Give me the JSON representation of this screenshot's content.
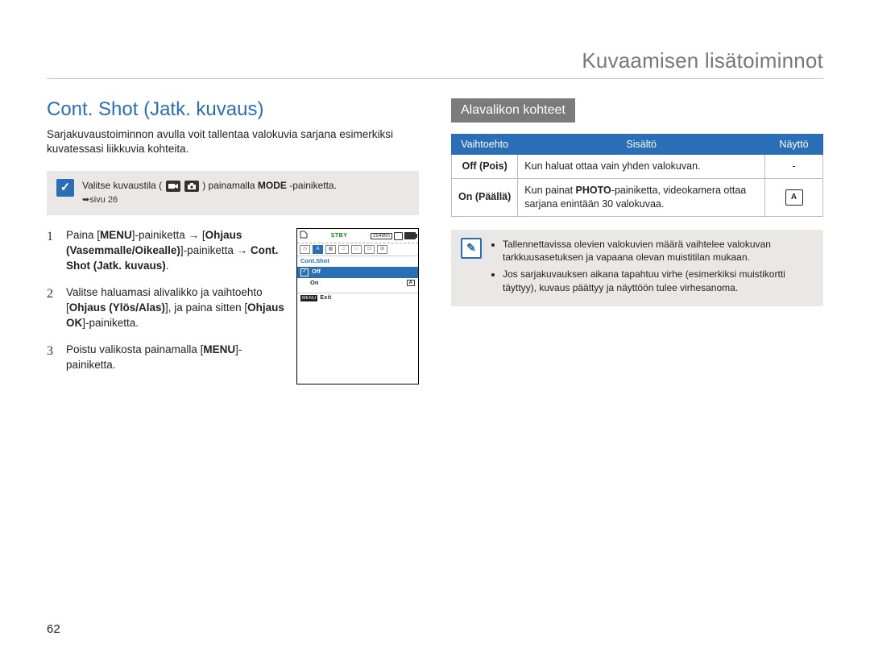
{
  "header": {
    "title": "Kuvaamisen lisätoiminnot"
  },
  "left": {
    "section_title": "Cont. Shot (Jatk. kuvaus)",
    "intro": "Sarjakuvaustoiminnon avulla voit tallentaa valokuvia sarjana esimerkiksi kuvatessasi liikkuvia kohteita.",
    "note": {
      "pre": "Valitse kuvaustila (",
      "post": ") painamalla ",
      "mode": "MODE",
      "suffix": "-painiketta.",
      "pageref": "➥sivu 26"
    },
    "steps": [
      {
        "num": "1",
        "parts": {
          "a": "Paina [",
          "menu": "MENU",
          "b": "]-painiketta ",
          "arrow1": "→",
          "c": " [",
          "ctrl_lr": "Ohjaus (Vasemmalle/Oikealle)",
          "d": "]-painiketta ",
          "arrow2": "→",
          "e": " ",
          "cont": "Cont. Shot (Jatk. kuvaus)",
          "end": "."
        }
      },
      {
        "num": "2",
        "parts": {
          "a": "Valitse haluamasi alivalikko ja vaihtoehto [",
          "ctrl_ud": "Ohjaus (Ylös/Alas)",
          "b": "], ja paina sitten [",
          "ctrl_ok": "Ohjaus OK",
          "c": "]-painiketta."
        }
      },
      {
        "num": "3",
        "parts": {
          "a": "Poistu valikosta painamalla [",
          "menu": "MENU",
          "b": "]-painiketta."
        }
      }
    ],
    "screen": {
      "stby": "STBY",
      "time": "254Min",
      "label": "Cont.Shot",
      "items": [
        {
          "text": "Off",
          "selected": true,
          "tick": "✓"
        },
        {
          "text": "On",
          "selected": false,
          "badge": "A"
        }
      ],
      "menu": "MENU",
      "exit": "Exit"
    }
  },
  "right": {
    "subhead": "Alavalikon kohteet",
    "table": {
      "headers": {
        "option": "Vaihtoehto",
        "content": "Sisältö",
        "display": "Näyttö"
      },
      "rows": [
        {
          "opt": "Off (Pois)",
          "content_pre": "Kun haluat ottaa vain yhden valokuvan.",
          "content_bold": "",
          "content_post": "",
          "display": "-",
          "display_is_icon": false
        },
        {
          "opt": "On (Päällä)",
          "content_pre": "Kun painat ",
          "content_bold": "PHOTO",
          "content_post": "-painiketta, videokamera ottaa sarjana enintään 30 valokuvaa.",
          "display": "A",
          "display_is_icon": true
        }
      ]
    },
    "info": [
      "Tallennettavissa olevien valokuvien määrä vaihtelee valokuvan tarkkuusasetuksen ja vapaana olevan muistitilan mukaan.",
      "Jos sarjakuvauksen aikana tapahtuu virhe (esimerkiksi muistikortti täyttyy), kuvaus päättyy ja näyttöön tulee virhesanoma."
    ]
  },
  "page_number": "62"
}
